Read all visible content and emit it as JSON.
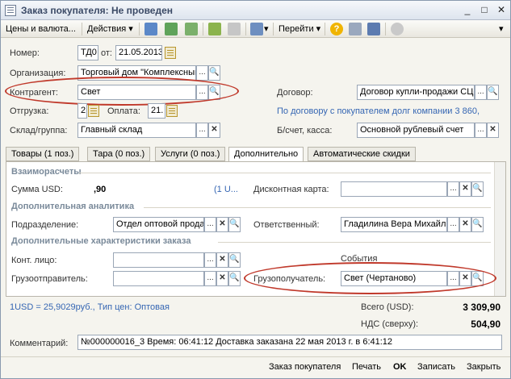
{
  "window": {
    "title": "Заказ покупателя: Не проведен"
  },
  "toolbar": {
    "prices_label": "Цены и валюта...",
    "actions_label": "Действия",
    "goto_label": "Перейти"
  },
  "header": {
    "number_label": "Номер:",
    "number_value": "ТД0",
    "date_from_label": "от:",
    "date_value": "21.05.2013",
    "org_label": "Организация:",
    "org_value": "Торговый дом \"Комплексный\"",
    "contractor_label": "Контрагент:",
    "contractor_value": "Свет",
    "contract_label": "Договор:",
    "contract_value": "Договор купли-продажи СЦ-",
    "shipment_label": "Отгрузка:",
    "shipment_value": "2",
    "payment_label": "Оплата:",
    "payment_value": "21.",
    "debt_link": "По договору с покупателем долг компании 3 860,",
    "warehouse_label": "Склад/группа:",
    "warehouse_value": "Главный склад",
    "account_label": "Б/счет, касса:",
    "account_value": "Основной рублевый счет"
  },
  "tabs": [
    {
      "label": "Товары (1 поз.)"
    },
    {
      "label": "Тара (0 поз.)"
    },
    {
      "label": "Услуги (0 поз.)"
    },
    {
      "label": "Дополнительно"
    },
    {
      "label": "Автоматические скидки"
    }
  ],
  "additional": {
    "settlements_title": "Взаиморасчеты",
    "sum_usd_label": "Сумма USD:",
    "sum_usd_value": ",90",
    "rate_link": "(1 U...",
    "discount_card_label": "Дисконтная карта:",
    "discount_card_value": "",
    "analytics_title": "Дополнительная аналитика",
    "division_label": "Подразделение:",
    "division_value": "Отдел оптовой прода",
    "responsible_label": "Ответственный:",
    "responsible_value": "Гладилина Вера Михайло",
    "order_chars_title": "Дополнительные характеристики заказа",
    "contact_label": "Конт. лицо:",
    "contact_value": "",
    "events_label": "События",
    "shipper_label": "Грузоотправитель:",
    "shipper_value": "",
    "consignee_label": "Грузополучатель:",
    "consignee_value": "Свет (Чертаново)"
  },
  "footer": {
    "rate_link": "1USD = 25,9029руб., Тип цен: Оптовая",
    "total_label": "Всего (USD):",
    "total_value": "3 309,90",
    "vat_label": "НДС (сверху):",
    "vat_value": "504,90",
    "comment_label": "Комментарий:",
    "comment_value": "№000000016_3 Время: 06:41:12 Доставка заказана 22 мая 2013 г. в 6:41:12"
  },
  "bottom_buttons": {
    "order_label": "Заказ покупателя",
    "print_label": "Печать",
    "ok_label": "OK",
    "save_label": "Записать",
    "close_label": "Закрыть"
  },
  "colors": {
    "accent_link": "#3566b3",
    "highlight_oval": "#c0392b",
    "section_title": "#7a8a9a"
  }
}
